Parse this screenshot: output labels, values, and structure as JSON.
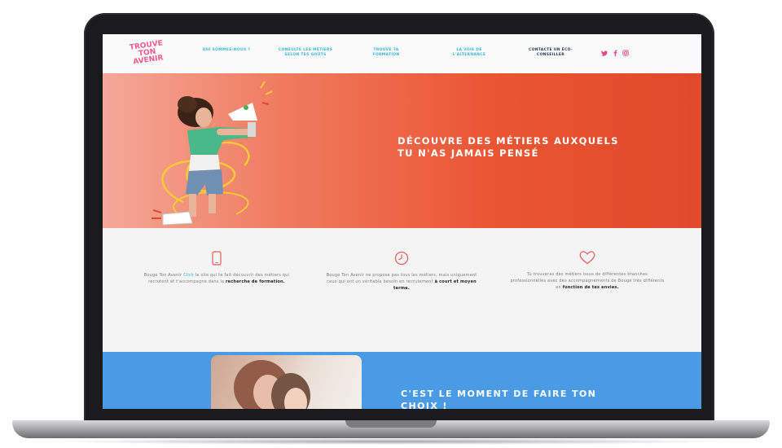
{
  "nav": {
    "logo": [
      "TROUVE",
      "TON",
      "AVENIR"
    ],
    "items": [
      {
        "label": "QUI SOMMES-NOUS ?"
      },
      {
        "label": "CONSULTE LES MÉTIERS SELON TES GOÛTS"
      },
      {
        "label": "TROUVE TA FORMATION"
      },
      {
        "label": "LA VOIE DE L'ALTERNANCE"
      },
      {
        "label": "CONTACTE UN ÉCO-CONSEILLER"
      }
    ],
    "social": [
      "twitter-icon",
      "facebook-icon",
      "instagram-icon"
    ]
  },
  "hero": {
    "title_line1": "DÉCOUVRE DES MÉTIERS AUXQUELS",
    "title_line2": "TU N'AS JAMAIS PENSÉ"
  },
  "features": [
    {
      "icon": "phone-icon",
      "text_a": "Bouge Ton Avenir",
      "text_link": "Click",
      "text_b": " le site qui te fait découvrir des métiers qui recrutent et t'accompagne dans la ",
      "bold": "recherche de formation."
    },
    {
      "icon": "clock-icon",
      "text_a": "Bouge Ton Avenir ne propose pas tous les métiers, mais uniquement ceux qui ont un véritable besoin en recrutement ",
      "text_link": "",
      "text_b": "",
      "bold": "à court et moyen terme."
    },
    {
      "icon": "heart-icon",
      "text_a": "Tu trouveras des métiers issus de différentes branches professionnelles avec des accompagnements de Bouge très différents en ",
      "text_link": "",
      "text_b": "",
      "bold": "fonction de tes envies."
    }
  ],
  "blue_section": {
    "title_line1": "C'EST LE MOMENT DE FAIRE TON",
    "title_line2": "CHOIX !"
  },
  "colors": {
    "accent_pink": "#e8488a",
    "accent_cyan": "#3ab6d6",
    "hero_orange": "#ea5533",
    "section_blue": "#4a9ae6"
  }
}
